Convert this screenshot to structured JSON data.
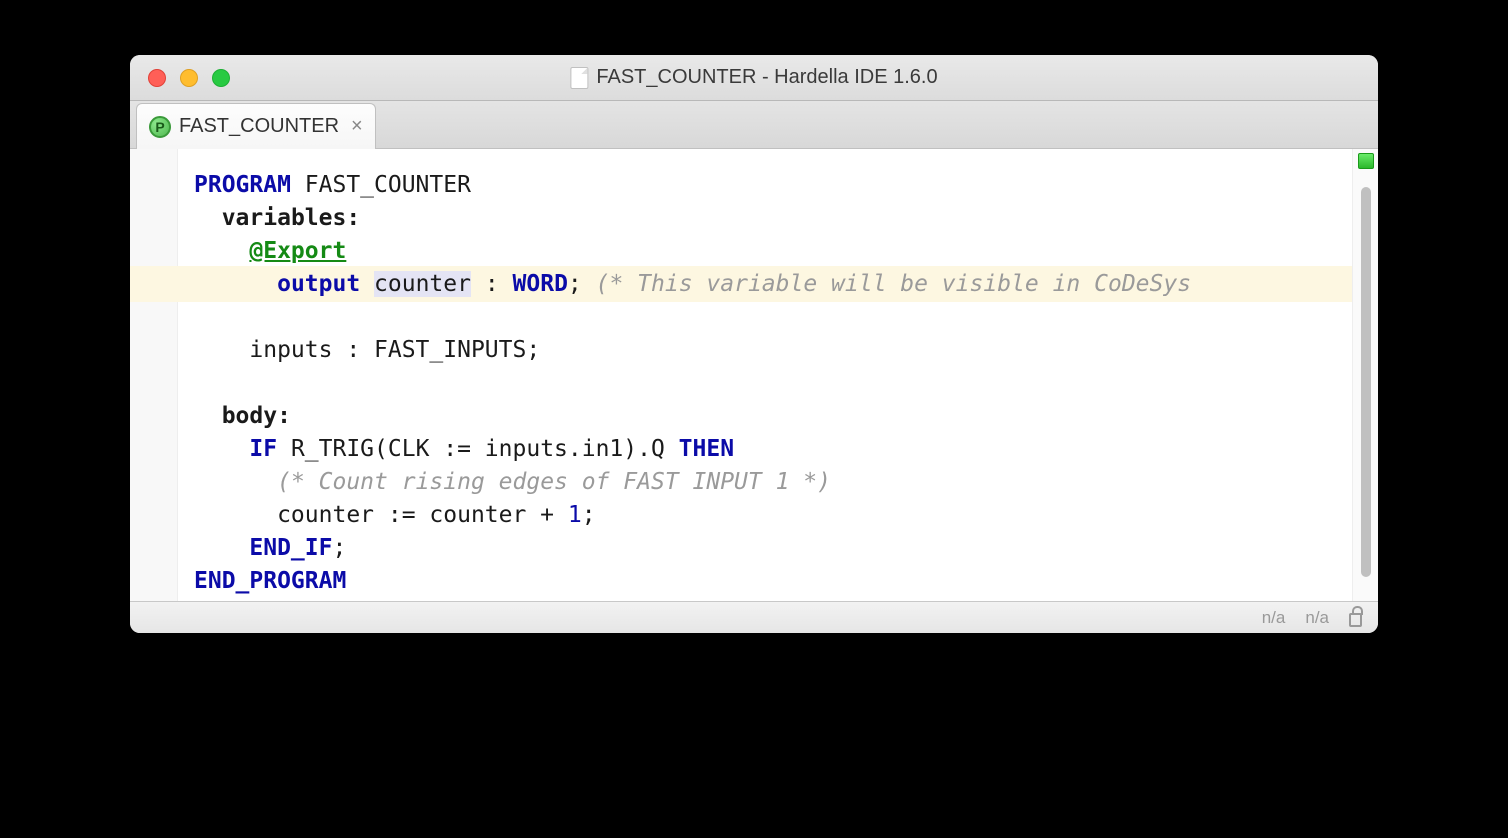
{
  "window": {
    "title": "FAST_COUNTER - Hardella IDE 1.6.0"
  },
  "tab": {
    "icon_letter": "P",
    "label": "FAST_COUNTER",
    "close": "×"
  },
  "code": {
    "l1_kw": "PROGRAM",
    "l1_rest": " FAST_COUNTER",
    "l2": "variables:",
    "l3_annotation": "@Export",
    "l4_kw1": "output",
    "l4_var": "counter",
    "l4_colon": " : ",
    "l4_kw2": "WORD",
    "l4_semi": ";",
    "l4_comment": " (* This variable will be visible in CoDeSys",
    "l5": "    inputs : FAST_INPUTS;",
    "l6": "body:",
    "l7_kw1": "IF",
    "l7_mid": " R_TRIG(CLK := inputs.in1).Q ",
    "l7_kw2": "THEN",
    "l8_comment": "(* Count rising edges of FAST INPUT 1 *)",
    "l9_pre": "      counter := counter + ",
    "l9_num": "1",
    "l9_post": ";",
    "l10_kw": "END_IF",
    "l10_semi": ";",
    "l11_kw": "END_PROGRAM"
  },
  "statusbar": {
    "pos1": "n/a",
    "pos2": "n/a"
  }
}
